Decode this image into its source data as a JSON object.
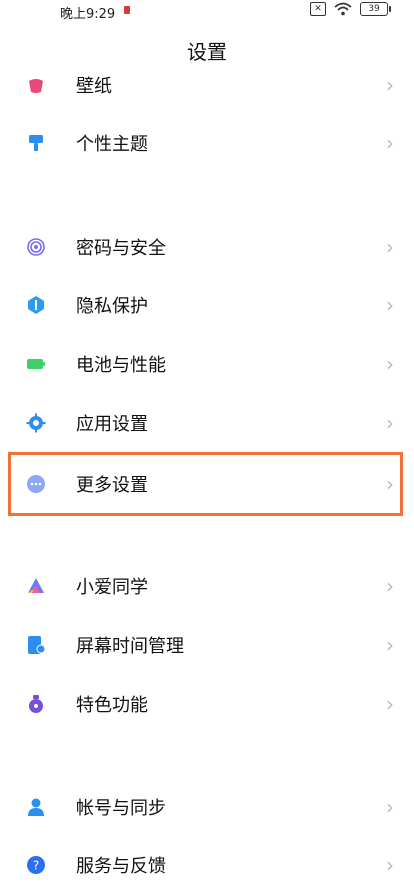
{
  "status": {
    "time": "晚上9:29",
    "battery": "39",
    "sim": "✕"
  },
  "title": "设置",
  "items": [
    {
      "label": "壁纸",
      "icon": "wallpaper-icon",
      "color": "#e8497a"
    },
    {
      "label": "个性主题",
      "icon": "theme-brush-icon",
      "color": "#2a8ff0"
    },
    {
      "label": "密码与安全",
      "icon": "fingerprint-icon",
      "color": "#7b6cf0"
    },
    {
      "label": "隐私保护",
      "icon": "privacy-shield-icon",
      "color": "#2b9cf2"
    },
    {
      "label": "电池与性能",
      "icon": "battery-icon",
      "color": "#3ecf6a"
    },
    {
      "label": "应用设置",
      "icon": "gear-icon",
      "color": "#2a8ff0"
    },
    {
      "label": "更多设置",
      "icon": "more-dots-icon",
      "color": "#8fa6f5"
    },
    {
      "label": "小爱同学",
      "icon": "xiaoai-icon",
      "color": "#6a7df2"
    },
    {
      "label": "屏幕时间管理",
      "icon": "screen-time-icon",
      "color": "#2a8ff0"
    },
    {
      "label": "特色功能",
      "icon": "feature-icon",
      "color": "#7a4fd8"
    },
    {
      "label": "帐号与同步",
      "icon": "account-icon",
      "color": "#2a8ff0"
    },
    {
      "label": "服务与反馈",
      "icon": "help-icon",
      "color": "#2a6ff0"
    }
  ],
  "chevron": "›",
  "highlight_color": "#f07236"
}
